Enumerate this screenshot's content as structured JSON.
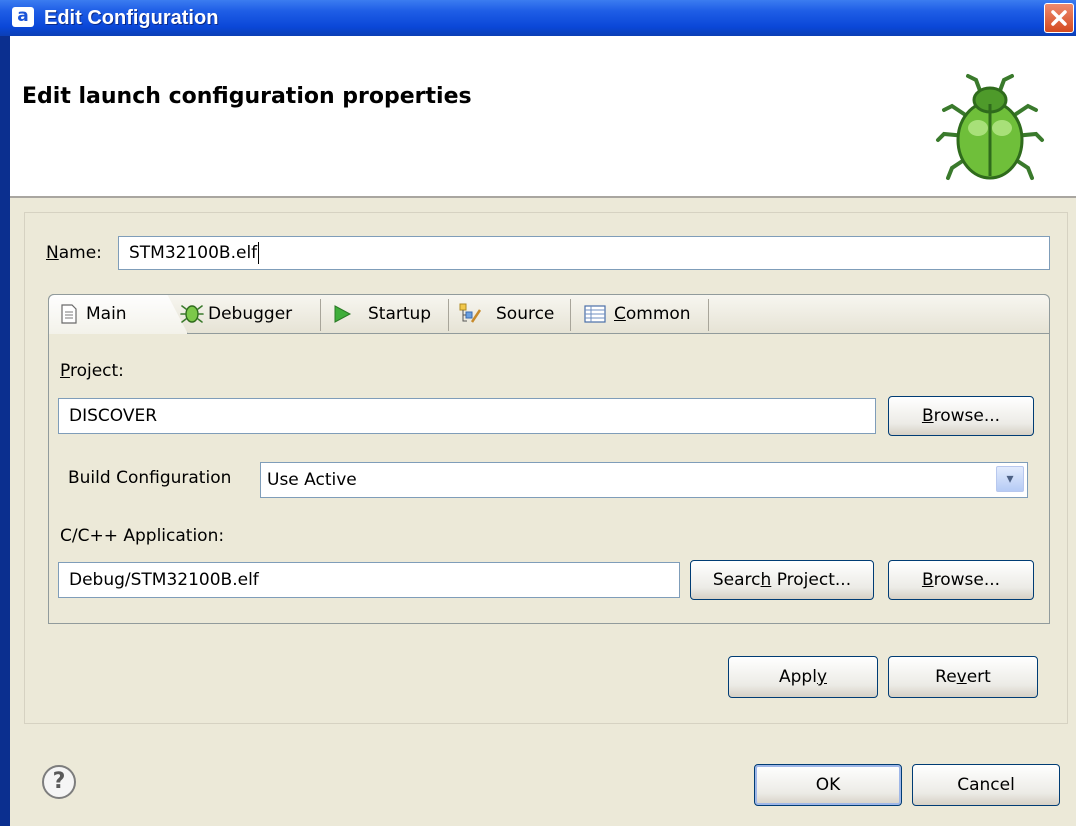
{
  "window": {
    "title": "Edit Configuration",
    "app_icon_glyph": "a",
    "close_glyph": "✕"
  },
  "header": {
    "title": "Edit launch configuration properties",
    "image": "bug-icon"
  },
  "name_field": {
    "label": "Name:",
    "value": "STM32100B.elf"
  },
  "tabs": [
    {
      "label": "Main",
      "icon": "document-icon",
      "selected": true
    },
    {
      "label": "Debugger",
      "icon": "debugger-bug-icon",
      "selected": false
    },
    {
      "label": "Startup",
      "icon": "play-icon",
      "selected": false
    },
    {
      "label": "Source",
      "icon": "source-icon",
      "selected": false
    },
    {
      "label": "Common",
      "icon": "common-icon",
      "selected": false
    }
  ],
  "main_tab": {
    "project_label": "Project:",
    "project_value": "DISCOVER",
    "browse_label": "Browse...",
    "build_config_label": "Build Configuration",
    "build_config_value": "Use Active",
    "app_label": "C/C++ Application:",
    "app_value": "Debug/STM32100B.elf",
    "search_project_label": "Search Project...",
    "browse2_label": "Browse..."
  },
  "actions": {
    "apply": "Apply",
    "revert": "Revert"
  },
  "footer": {
    "help_glyph": "?",
    "ok": "OK",
    "cancel": "Cancel"
  },
  "colors": {
    "titlebar": "#1f5ee6",
    "dialog_bg": "#ece9d8",
    "input_border": "#7f9db9",
    "close_button": "#d44a1f"
  }
}
